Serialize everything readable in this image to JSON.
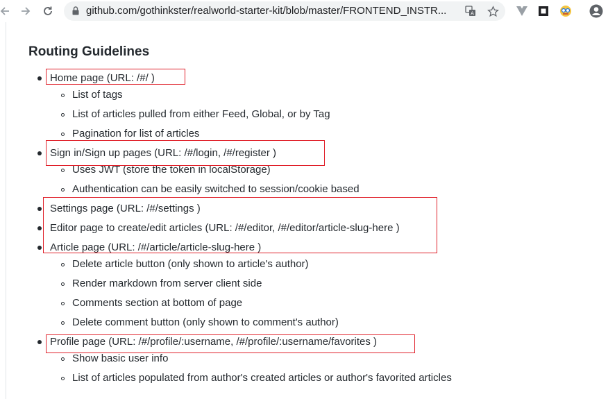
{
  "browser": {
    "url": "github.com/gothinkster/realworld-starter-kit/blob/master/FRONTEND_INSTR...",
    "highlight_color": "#e0202a"
  },
  "doc": {
    "heading": "Routing Guidelines",
    "top_items": [
      "Home page (URL: /#/ )",
      "Sign in/Sign up pages (URL: /#/login, /#/register )",
      "Settings page (URL: /#/settings )",
      "Editor page to create/edit articles (URL: /#/editor, /#/editor/article-slug-here )",
      "Article page (URL: /#/article/article-slug-here )",
      "Profile page (URL: /#/profile/:username, /#/profile/:username/favorites )"
    ],
    "home_sub": [
      "List of tags",
      "List of articles pulled from either Feed, Global, or by Tag",
      "Pagination for list of articles"
    ],
    "auth_sub": [
      "Uses JWT (store the token in localStorage)",
      "Authentication can be easily switched to session/cookie based"
    ],
    "article_sub": [
      "Delete article button (only shown to article's author)",
      "Render markdown from server client side",
      "Comments section at bottom of page",
      "Delete comment button (only shown to comment's author)"
    ],
    "profile_sub": [
      "Show basic user info",
      "List of articles populated from author's created articles or author's favorited articles"
    ]
  }
}
